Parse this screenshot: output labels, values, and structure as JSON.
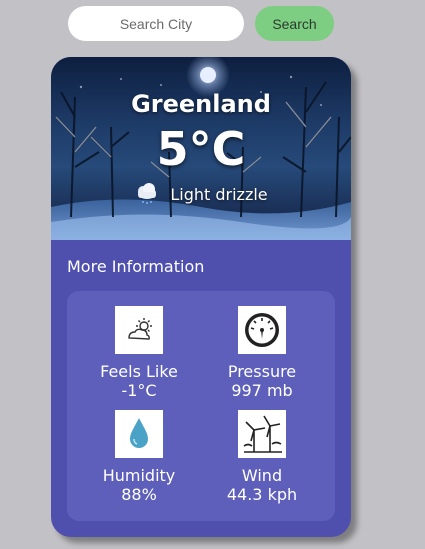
{
  "search": {
    "placeholder": "Search City",
    "button_label": "Search"
  },
  "weather": {
    "city": "Greenland",
    "temperature": "5°C",
    "condition": "Light drizzle",
    "condition_icon": "drizzle-cloud-icon"
  },
  "more_info": {
    "title": "More Information",
    "metrics": [
      {
        "label": "Feels Like",
        "value": "-1°C",
        "icon": "sun-cloud-icon"
      },
      {
        "label": "Pressure",
        "value": "997 mb",
        "icon": "gauge-icon"
      },
      {
        "label": "Humidity",
        "value": "88%",
        "icon": "droplet-icon"
      },
      {
        "label": "Wind",
        "value": "44.3 kph",
        "icon": "wind-turbine-icon"
      }
    ]
  },
  "colors": {
    "page_background": "#c2c1c5",
    "search_button": "#7dce82",
    "card_background": "#4f4fae",
    "info_panel": "#5e5fba",
    "droplet": "#4aa3c7"
  }
}
